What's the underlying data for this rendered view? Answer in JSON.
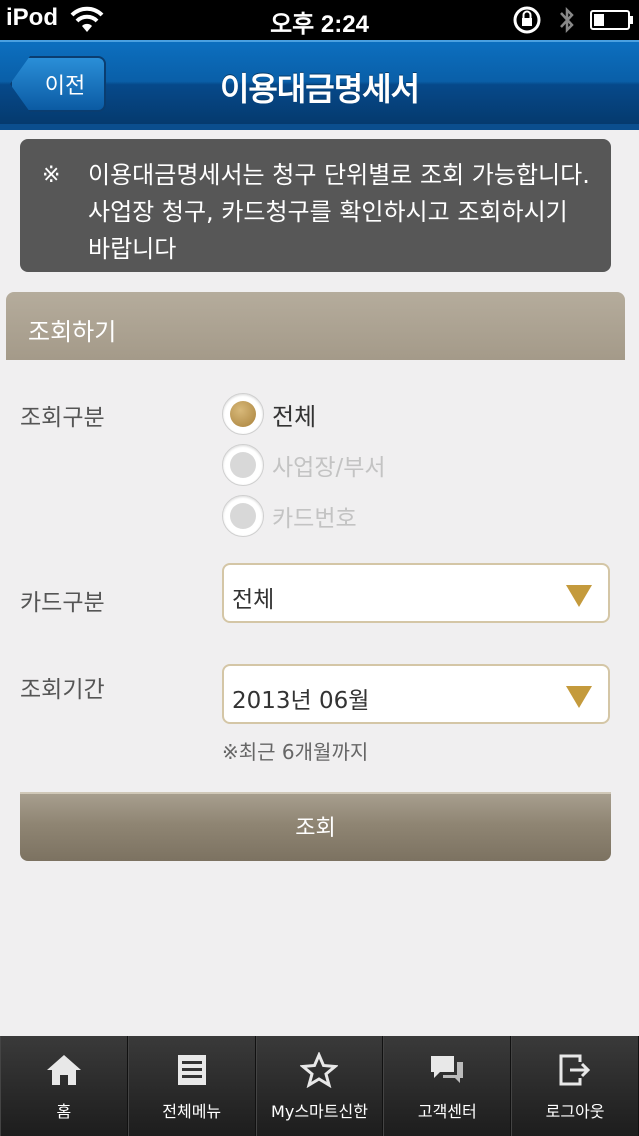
{
  "status_bar": {
    "carrier": "iPod",
    "time": "오후 2:24"
  },
  "nav": {
    "back_label": "이전",
    "title": "이용대금명세서"
  },
  "notice": {
    "mark": "※",
    "text": "이용대금명세서는 청구 단위별로 조회 가능합니다. 사업장 청구, 카드청구를 확인하시고 조회하시기 바랍니다"
  },
  "section": {
    "title": "조회하기"
  },
  "form": {
    "query_type_label": "조회구분",
    "query_type_options": [
      {
        "label": "전체",
        "selected": true
      },
      {
        "label": "사업장/부서",
        "selected": false
      },
      {
        "label": "카드번호",
        "selected": false
      }
    ],
    "card_type_label": "카드구분",
    "card_type_value": "전체",
    "period_label": "조회기간",
    "period_value": "2013년 06월",
    "period_hint": "※최근 6개월까지",
    "submit_label": "조회"
  },
  "tabbar": [
    {
      "label": "홈",
      "icon": "home-icon"
    },
    {
      "label": "전체메뉴",
      "icon": "menu-icon"
    },
    {
      "label": "My스마트신한",
      "icon": "star-icon"
    },
    {
      "label": "고객센터",
      "icon": "chat-icon"
    },
    {
      "label": "로그아웃",
      "icon": "logout-icon"
    }
  ],
  "colors": {
    "nav_blue": "#0a5fa8",
    "accent_gold": "#c49a3c",
    "section_tan": "#a79e8e"
  }
}
